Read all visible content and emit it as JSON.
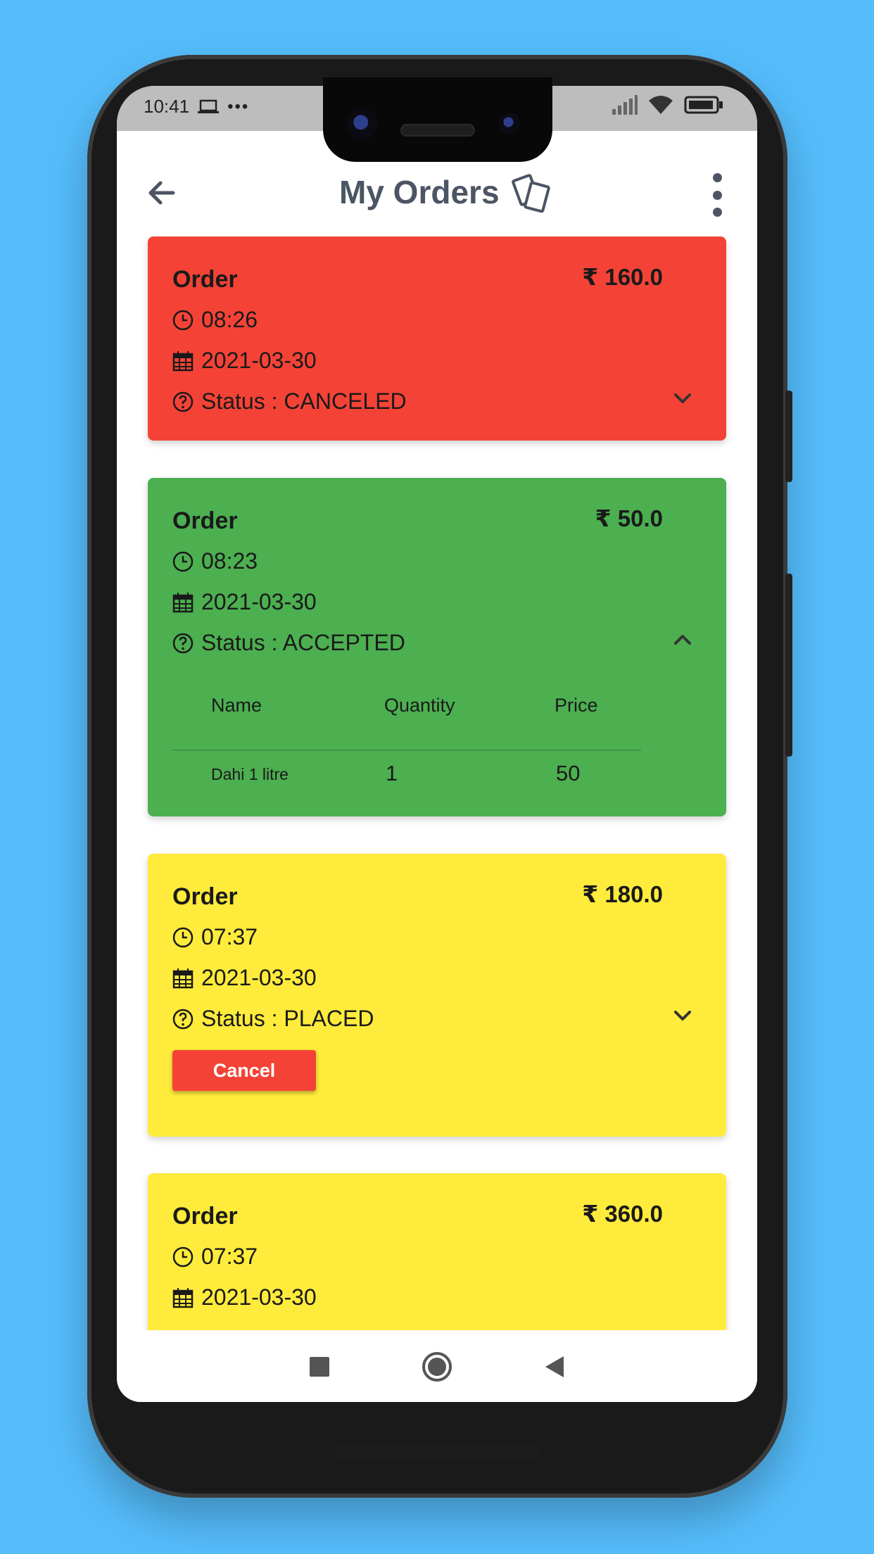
{
  "status_bar": {
    "time": "10:41",
    "dots": "•••"
  },
  "header": {
    "title": "My Orders"
  },
  "orders": [
    {
      "label": "Order",
      "price": "₹ 160.0",
      "time": "08:26",
      "date": "2021-03-30",
      "status": "Status : CANCELED",
      "color": "#f44336"
    },
    {
      "label": "Order",
      "price": "₹ 50.0",
      "time": "08:23",
      "date": "2021-03-30",
      "status": "Status : ACCEPTED",
      "color": "#4caf50",
      "table": {
        "headers": [
          "Name",
          "Quantity",
          "Price"
        ],
        "rows": [
          {
            "name": "Dahi 1 litre",
            "quantity": "1",
            "price": "50"
          }
        ]
      }
    },
    {
      "label": "Order",
      "price": "₹ 180.0",
      "time": "07:37",
      "date": "2021-03-30",
      "status": "Status : PLACED",
      "color": "#ffeb3b",
      "cancel_label": "Cancel"
    },
    {
      "label": "Order",
      "price": "₹ 360.0",
      "time": "07:37",
      "date": "2021-03-30",
      "color": "#ffeb3b"
    }
  ],
  "colors": {
    "background": "#55bdfc",
    "title": "#4b5563",
    "canceled": "#f44336",
    "accepted": "#4caf50",
    "placed": "#ffeb3b"
  }
}
